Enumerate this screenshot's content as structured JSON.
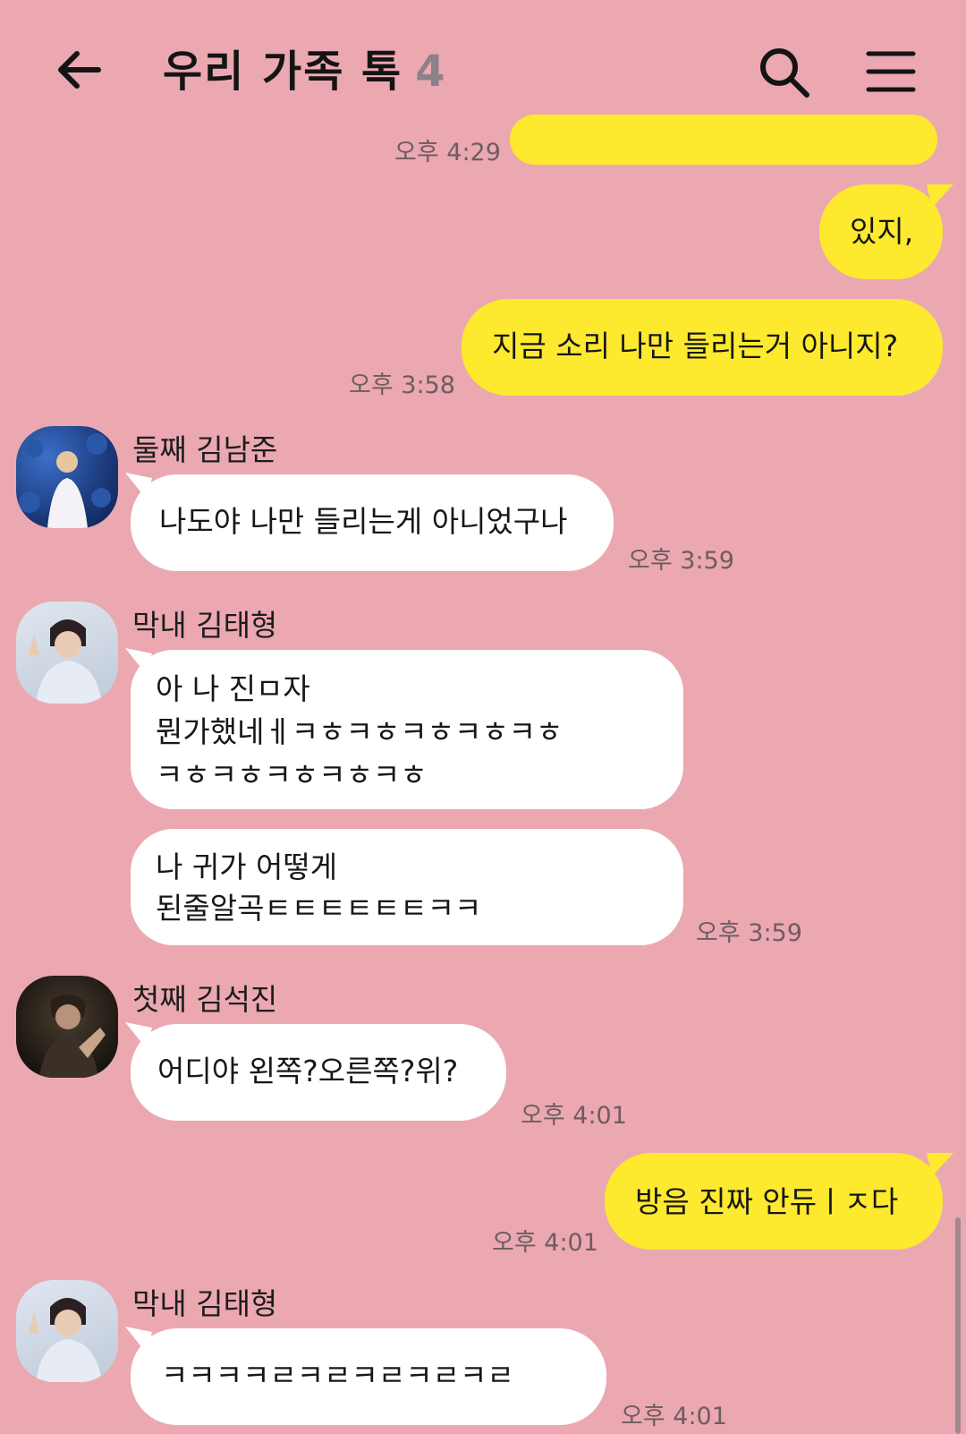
{
  "header": {
    "title": "우리 가족 톡",
    "member_count": "4",
    "back_icon": "arrow-left-icon",
    "search_icon": "search-icon",
    "menu_icon": "hamburger-menu-icon"
  },
  "messages": [
    {
      "side": "me",
      "text": "",
      "time": "오후 4:29"
    },
    {
      "side": "me",
      "text": "있지,"
    },
    {
      "side": "me",
      "text": "지금 소리 나만 들리는거 아니지?",
      "time": "오후 3:58"
    },
    {
      "side": "other",
      "sender": "둘째 김남준",
      "lines": [
        "나도야 나만 들리는게 아니었구나"
      ],
      "time": "오후 3:59"
    },
    {
      "side": "other",
      "sender": "막내 김태형",
      "lines": [
        "아 나 진ㅁ자",
        "뭔가했네ㅔㅋㅎㅋㅎㅋㅎㅋㅎㅋㅎ",
        "ㅋㅎㅋㅎㅋㅎㅋㅎㅋㅎ"
      ]
    },
    {
      "side": "other",
      "lines": [
        "나 귀가 어떻게",
        "된줄알곡ㅌㅌㅌㅌㅌㅌㅋㅋ"
      ],
      "time": "오후 3:59"
    },
    {
      "side": "other",
      "sender": "첫째 김석진",
      "lines": [
        "어디야 왼쪽?오른쪽?위?"
      ],
      "time": "오후 4:01"
    },
    {
      "side": "me",
      "text": "방음 진짜 안듀ㅣㅈ다",
      "time": "오후 4:01"
    },
    {
      "side": "other",
      "sender": "막내 김태형",
      "lines": [
        "ㅋㅋㅋㅋㄹㅋㄹㅋㄹㅋㄹㅋㄹ"
      ],
      "time": "오후 4:01"
    }
  ],
  "colors": {
    "background": "#eba8b1",
    "my_bubble": "#fde92e",
    "other_bubble": "#ffffff"
  }
}
